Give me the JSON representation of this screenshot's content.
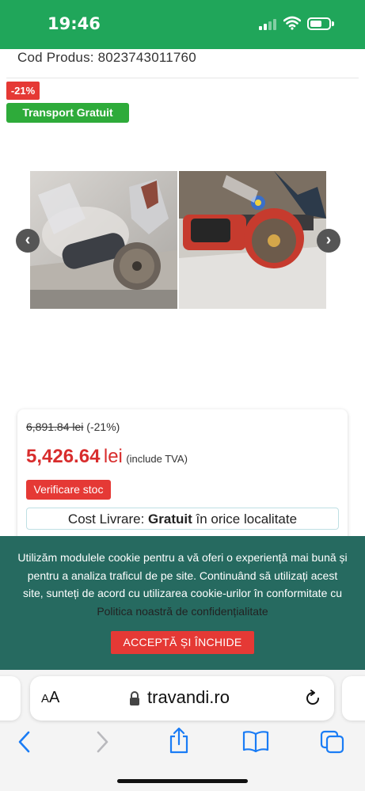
{
  "status_bar": {
    "time": "19:46"
  },
  "product": {
    "code_label": "Cod Produs: 8023743011760",
    "discount_badge": "-21%",
    "shipping_badge": "Transport Gratuit"
  },
  "gallery": {
    "images": [
      "angle-grinder-cutting-photo",
      "cutting-saw-photo"
    ]
  },
  "pricing": {
    "old_price": "6,891.84 lei",
    "old_discount": "(-21%)",
    "new_price": "5,426.64",
    "currency": "lei",
    "vat_note": "(include TVA)",
    "stock_button": "Verificare stoc",
    "delivery_prefix": "Cost Livrare:",
    "delivery_value": "Gratuit",
    "delivery_suffix": "în orice localitate"
  },
  "cookie": {
    "text": "Utilizăm modulele cookie pentru a vă oferi o experiență mai bună și pentru a analiza traficul de pe site. Continuând să utilizați acest site, sunteți de acord cu utilizarea cookie-urilor în conformitate cu",
    "link": "Politica noastră de confidențialitate",
    "accept_button": "ACCEPTĂ ȘI ÎNCHIDE"
  },
  "browser": {
    "aa_small": "A",
    "aa_large": "A",
    "url": "travandi.ro"
  },
  "colors": {
    "brand_green": "#20a65a",
    "badge_red": "#e53935",
    "price_red": "#d82d2d",
    "cookie_bg": "#266a60",
    "ios_blue": "#1a7cf5"
  }
}
